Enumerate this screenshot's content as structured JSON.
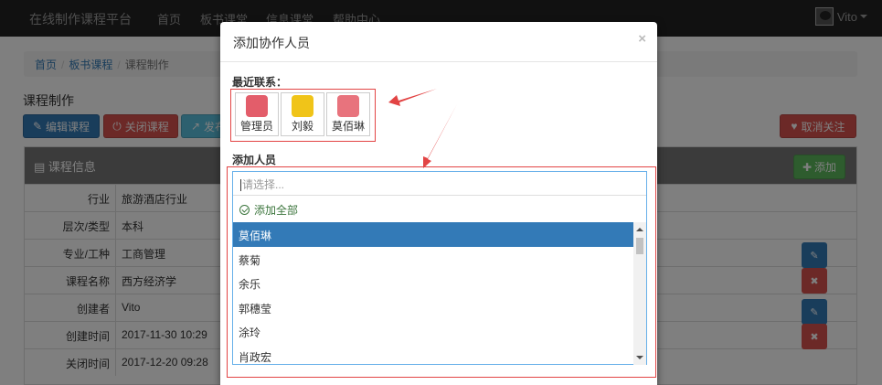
{
  "navbar": {
    "brand": "在线制作课程平台",
    "items": [
      "首页",
      "板书课堂",
      "信息课堂",
      "帮助中心"
    ],
    "user": "Vito"
  },
  "breadcrumb": [
    "首页",
    "板书课程",
    "课程制作"
  ],
  "page_title": "课程制作",
  "toolbar": {
    "edit": "编辑课程",
    "close": "关闭课程",
    "publish": "发布",
    "unfollow": "取消关注"
  },
  "panel": {
    "title": "课程信息",
    "add_label": "添加",
    "rows": [
      {
        "k": "行业",
        "v": "旅游酒店行业"
      },
      {
        "k": "层次/类型",
        "v": "本科"
      },
      {
        "k": "专业/工种",
        "v": "工商管理"
      },
      {
        "k": "课程名称",
        "v": "西方经济学"
      },
      {
        "k": "创建者",
        "v": "Vito"
      },
      {
        "k": "创建时间",
        "v": "2017-11-30 10:29"
      },
      {
        "k": "关闭时间",
        "v": "2017-12-20 09:28"
      }
    ]
  },
  "modal": {
    "title": "添加协作人员",
    "close": "×",
    "recent_label": "最近联系：",
    "recent_contacts": [
      "管理员",
      "刘毅",
      "莫佰琳"
    ],
    "add_label": "添加人员",
    "placeholder": "请选择...",
    "add_all": "添加全部",
    "options": [
      "莫佰琳",
      "蔡菊",
      "余乐",
      "郭穗莹",
      "涂玲",
      "肖政宏"
    ]
  },
  "colors": {
    "accent": "#337ab7",
    "danger": "#d9534f",
    "success": "#5cb85c",
    "annotation": "#e24444"
  }
}
